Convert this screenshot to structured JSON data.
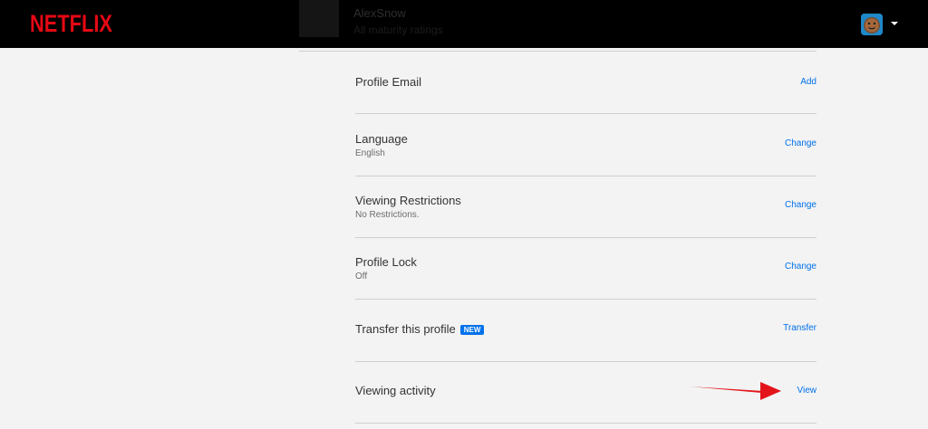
{
  "brand": {
    "logo_text": "NETFLIX",
    "logo_color": "#e50914"
  },
  "header": {
    "profile_name": "AlexSnow",
    "profile_subtitle": "All maturity ratings"
  },
  "settings": {
    "rows": [
      {
        "title": "Profile Email",
        "subtitle": "",
        "action": "Add"
      },
      {
        "title": "Language",
        "subtitle": "English",
        "action": "Change"
      },
      {
        "title": "Viewing Restrictions",
        "subtitle": "No Restrictions.",
        "action": "Change"
      },
      {
        "title": "Profile Lock",
        "subtitle": "Off",
        "action": "Change"
      },
      {
        "title": "Transfer this profile",
        "badge": "NEW",
        "subtitle": "",
        "action": "Transfer"
      },
      {
        "title": "Viewing activity",
        "subtitle": "",
        "action": "View"
      }
    ]
  },
  "colors": {
    "link": "#0071eb",
    "annotation_arrow": "#e3151a",
    "header_background": "#000000",
    "page_background": "#f3f3f3"
  },
  "icons": {
    "account_avatar": "smiley-face-avatar-icon",
    "account_menu": "caret-down-icon",
    "annotation": "red-arrow-icon"
  }
}
